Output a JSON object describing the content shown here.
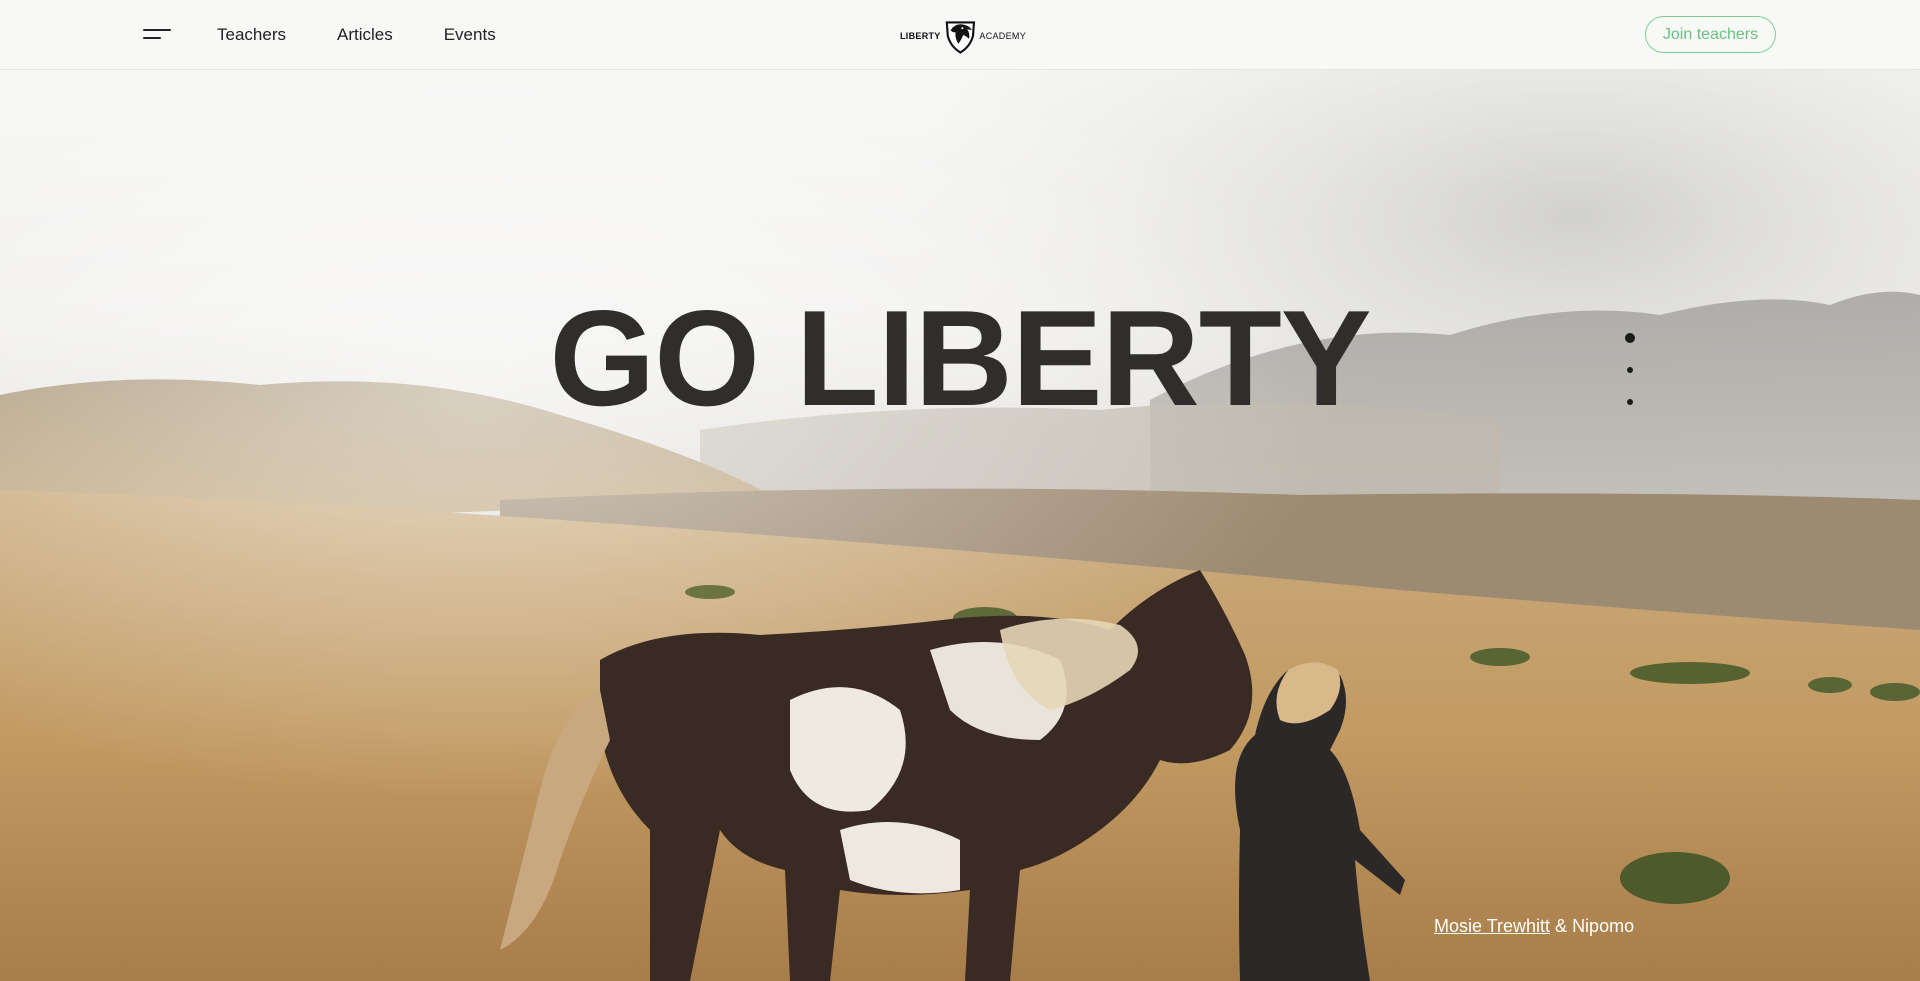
{
  "header": {
    "menu_icon": "hamburger-menu-icon",
    "nav": [
      {
        "label": "Teachers"
      },
      {
        "label": "Articles"
      },
      {
        "label": "Events"
      }
    ],
    "logo": {
      "left_word": "LIBERTY",
      "right_word": "ACADEMY",
      "icon": "horse-head-shield-icon"
    },
    "join_label": "Join teachers"
  },
  "hero": {
    "title": "GO LIBERTY",
    "slides": {
      "count": 3,
      "active": 1
    },
    "credit": {
      "author": "Mosie Trewhitt",
      "separator": " & ",
      "horse": "Nipomo"
    }
  },
  "colors": {
    "accent_green": "#69c283",
    "title_text": "#2f2e2d",
    "header_bg": "#f8f8f7"
  }
}
